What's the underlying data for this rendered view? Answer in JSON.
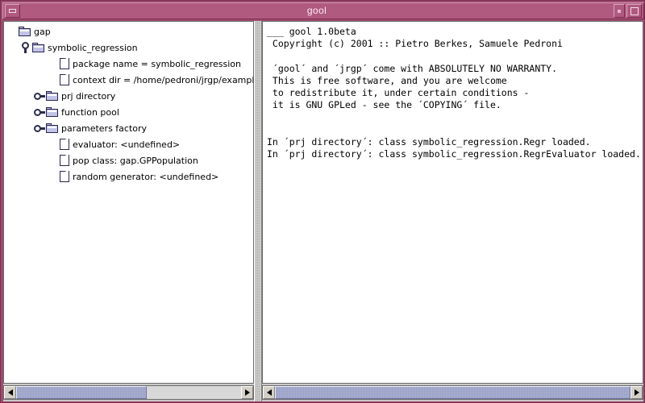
{
  "window": {
    "title": "gool",
    "buttons": {
      "minimize": "minimize",
      "shade": "shade",
      "maximize": "maximize"
    }
  },
  "tree": {
    "nodes": [
      {
        "indent": 0,
        "handle": "none",
        "icon": "folder-icon",
        "label": "gap"
      },
      {
        "indent": 1,
        "handle": "expanded",
        "icon": "folder-icon",
        "label": "symbolic_regression"
      },
      {
        "indent": 3,
        "handle": "none",
        "icon": "page-icon",
        "label": "package name = symbolic_regression"
      },
      {
        "indent": 3,
        "handle": "none",
        "icon": "page-icon",
        "label": "context dir = /home/pedroni/jrgp/examples;"
      },
      {
        "indent": 2,
        "handle": "collapsed",
        "icon": "folder-icon",
        "label": "prj directory"
      },
      {
        "indent": 2,
        "handle": "collapsed",
        "icon": "folder-icon",
        "label": "function pool"
      },
      {
        "indent": 2,
        "handle": "collapsed",
        "icon": "folder-icon",
        "label": "parameters factory"
      },
      {
        "indent": 3,
        "handle": "none",
        "icon": "page-icon",
        "label": "evaluator: <undefined>"
      },
      {
        "indent": 3,
        "handle": "none",
        "icon": "page-icon",
        "label": "pop class: gap.GPPopulation"
      },
      {
        "indent": 3,
        "handle": "none",
        "icon": "page-icon",
        "label": "random generator: <undefined>"
      }
    ]
  },
  "console": {
    "text": "___ gool 1.0beta\n Copyright (c) 2001 :: Pietro Berkes, Samuele Pedroni\n\n ´gool´ and ´jrgp´ come with ABSOLUTELY NO WARRANTY.\n This is free software, and you are welcome\n to redistribute it, under certain conditions -\n it is GNU GPLed - see the ´COPYING´ file.\n\n\nIn ´prj directory´: class symbolic_regression.Regr loaded.\nIn ´prj directory´: class symbolic_regression.RegrEvaluator loaded."
  },
  "scrollbars": {
    "left": {
      "thumb_start_pct": 0,
      "thumb_width_pct": 58
    },
    "right": {
      "thumb_start_pct": 0,
      "thumb_width_pct": 100
    }
  },
  "colors": {
    "titlebar": "#b05a80",
    "frame": "#9e4c6e",
    "pane_background": "#ffffff",
    "chrome": "#d4d0c8",
    "scroll_thumb": "#b8bcd8",
    "icon_outline": "#26264f",
    "folder_fill": "#c3c3e8"
  }
}
